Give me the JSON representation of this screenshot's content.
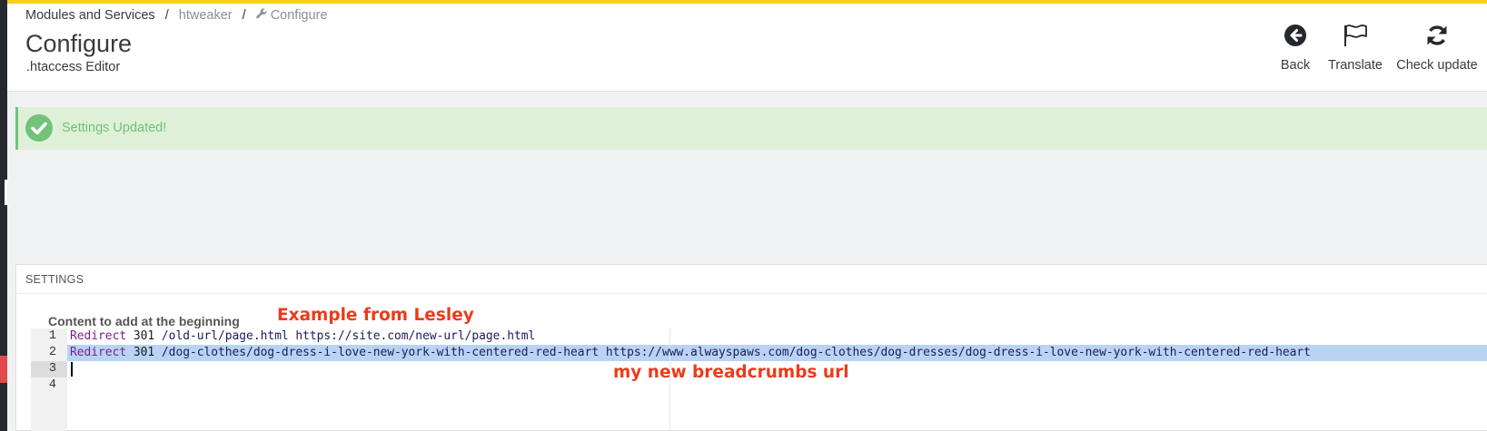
{
  "breadcrumb": {
    "items": [
      "Modules and Services",
      "htweaker",
      "Configure"
    ],
    "separator": "/"
  },
  "header": {
    "title": "Configure",
    "subtitle": ".htaccess Editor"
  },
  "toolbar": {
    "back_label": "Back",
    "translate_label": "Translate",
    "check_update_label": "Check update"
  },
  "alert": {
    "message": "Settings Updated!"
  },
  "panel": {
    "heading": "SETTINGS",
    "field_label": "Content to add at the beginning"
  },
  "editor": {
    "line_numbers": [
      "1",
      "2",
      "3",
      "4"
    ],
    "lines": [
      {
        "keyword": "Redirect",
        "code": "301",
        "path": "/old-url/page.html https://site.com/new-url/page.html"
      },
      {
        "keyword": "Redirect",
        "code": "301",
        "path": "/dog-clothes/dog-dress-i-love-new-york-with-centered-red-heart https://www.alwayspaws.com/dog-clothes/dog-dresses/dog-dress-i-love-new-york-with-centered-red-heart"
      }
    ]
  },
  "annotations": {
    "note_1": "Example from Lesley",
    "note_2": "my new breadcrumbs url"
  },
  "colors": {
    "top_accent": "#f7d117",
    "success_bg": "#dff0d8",
    "success_text": "#72c279",
    "selection": "#b9d4f3",
    "annotation": "#ea3b1a",
    "keyword": "#7a1f8a"
  },
  "icons": [
    "wrench-icon",
    "back-arrow-icon",
    "flag-icon",
    "refresh-icon",
    "check-circle-icon"
  ]
}
